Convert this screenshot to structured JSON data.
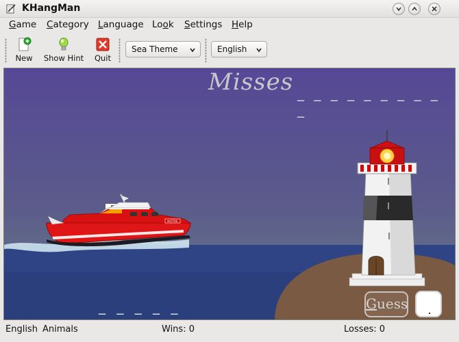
{
  "window": {
    "title": "KHangMan"
  },
  "menubar": {
    "items": [
      {
        "label": "Game",
        "mnemonic": "G",
        "rest": "ame"
      },
      {
        "label": "Category",
        "mnemonic": "C",
        "rest": "ategory"
      },
      {
        "label": "Language",
        "mnemonic": "L",
        "rest": "anguage"
      },
      {
        "label": "Look",
        "pre": "Lo",
        "mnemonic": "o",
        "rest": "k"
      },
      {
        "label": "Settings",
        "mnemonic": "S",
        "rest": "ettings"
      },
      {
        "label": "Help",
        "mnemonic": "H",
        "rest": "elp"
      }
    ]
  },
  "toolbar": {
    "new_label": "New",
    "hint_label": "Show Hint",
    "quit_label": "Quit",
    "theme_value": "Sea Theme",
    "language_value": "English"
  },
  "game": {
    "misses_label": "Misses",
    "misses_dashes": "_ _ _ _ _ _ _ _ _ _",
    "word_dashes": "_ _ _ _ _",
    "guess_label": "Guess",
    "guess_mnemonic": "G",
    "guess_rest": "uess",
    "guess_value": "",
    "boat_name": "NOTRE"
  },
  "statusbar": {
    "language": "English",
    "category": "Animals",
    "wins": "Wins: 0",
    "losses": "Losses: 0"
  },
  "colors": {
    "sky_top": "#564896",
    "sea": "#2a3f7c",
    "island": "#7a5a42",
    "boat_hull": "#e01515"
  }
}
